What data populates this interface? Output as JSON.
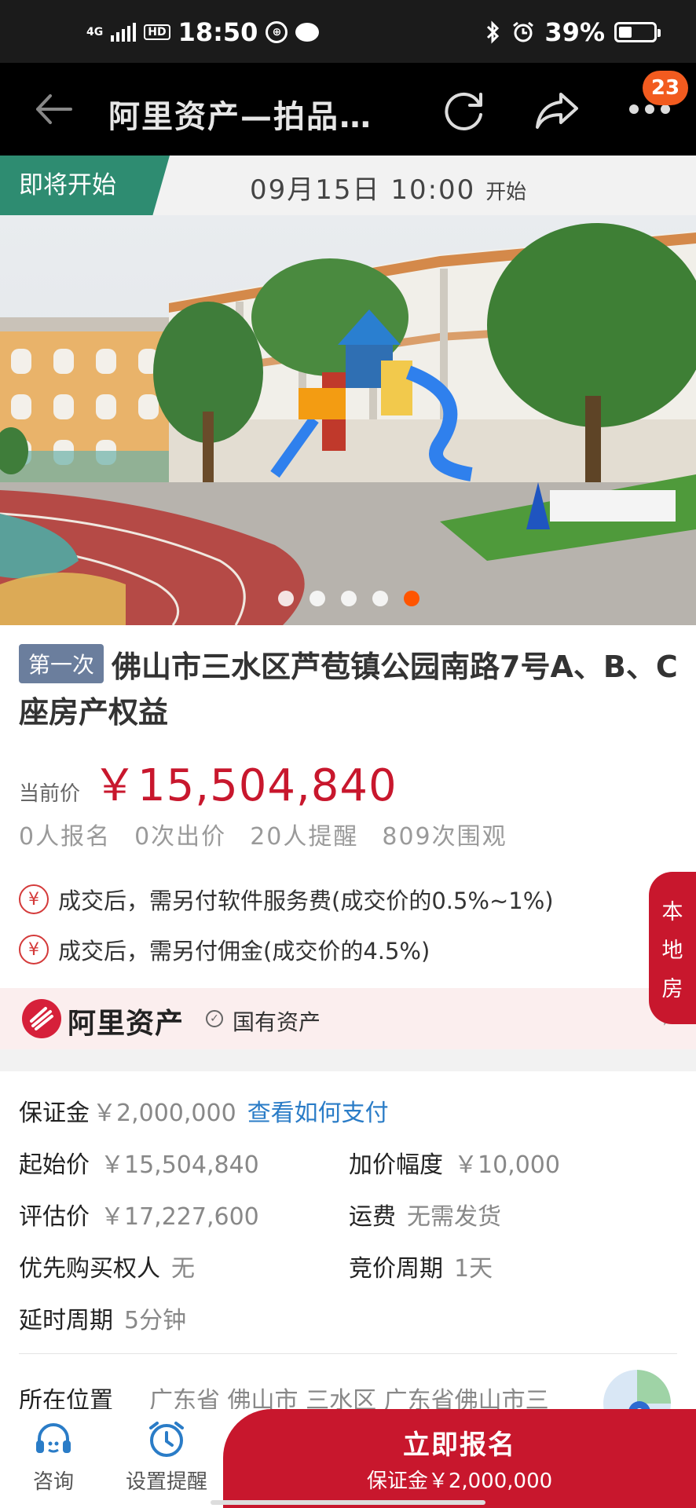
{
  "status_bar": {
    "network": "4G",
    "hd": "HD",
    "time": "18:50",
    "nfc_icon": "nfc-icon",
    "battery": "39%",
    "battery_level": 0.39
  },
  "nav": {
    "title": "阿里资产—拍品…",
    "badge": "23"
  },
  "auction": {
    "status_tag": "即将开始",
    "start_time": "09月15日 10:00",
    "start_suffix": "开始"
  },
  "carousel": {
    "count": 5,
    "active_index": 4
  },
  "item": {
    "round_tag": "第一次",
    "title": "佛山市三水区芦苞镇公园南路7号A、B、C座房产权益",
    "price_label": "当前价",
    "price": "￥15,504,840",
    "stats": [
      "0人报名",
      "0次出价",
      "20人提醒",
      "809次围观"
    ],
    "fees": [
      "成交后，需另付软件服务费(成交价的0.5%~1%)",
      "成交后，需另付佣金(成交价的4.5%)"
    ],
    "fee_icon_char": "¥"
  },
  "side_tab": {
    "label": [
      "本",
      "地",
      "房"
    ]
  },
  "org": {
    "name": "阿里资产",
    "tag": "国有资产",
    "check_char": "✓",
    "arrow": "›"
  },
  "details": {
    "deposit_label": "保证金",
    "deposit_value": "￥2,000,000",
    "deposit_link": "查看如何支付",
    "start_price_label": "起始价",
    "start_price_value": "￥15,504,840",
    "increment_label": "加价幅度",
    "increment_value": "￥10,000",
    "appraisal_label": "评估价",
    "appraisal_value": "￥17,227,600",
    "shipping_label": "运费",
    "shipping_value": "无需发货",
    "priority_label": "优先购买权人",
    "priority_value": "无",
    "cycle_label": "竞价周期",
    "cycle_value": "1天",
    "delay_label": "延时周期",
    "delay_value": "5分钟",
    "location_label": "所在位置",
    "location_value": "广东省 佛山市 三水区 广东省佛山市三"
  },
  "bottom_bar": {
    "consult_label": "咨询",
    "reminder_label": "设置提醒",
    "apply_label": "立即报名",
    "apply_sub": "保证金￥2,000,000"
  },
  "colors": {
    "accent_red": "#c8172d",
    "status_green": "#2e8c71",
    "link_blue": "#2a7cc7",
    "badge_orange": "#f25b1f"
  }
}
